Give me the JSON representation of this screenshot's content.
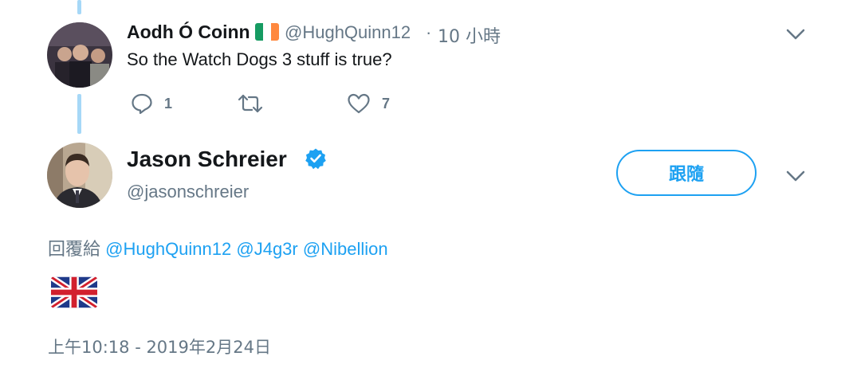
{
  "reply_tweet": {
    "display_name": "Aodh Ó Coinn",
    "handle": "@HughQuinn12",
    "separator": "·",
    "time_ago": "10 小時",
    "text": "So the Watch Dogs 3 stuff is true?",
    "reply_count": "1",
    "retweet_count": "",
    "like_count": "7",
    "icons": [
      "ireland-flag-emoji",
      "reply-icon",
      "retweet-icon",
      "like-icon",
      "chevron-down-icon"
    ]
  },
  "main_tweet": {
    "display_name": "Jason Schreier",
    "handle": "@jasonschreier",
    "follow_label": "跟隨",
    "replying_to_label": "回覆給",
    "mentions": [
      "@HughQuinn12",
      "@J4g3r",
      "@Nibellion"
    ],
    "timestamp": "上午10:18 - 2019年2月24日",
    "icons": [
      "verified-badge-icon",
      "uk-flag-emoji",
      "chevron-down-icon"
    ]
  },
  "colors": {
    "accent": "#1da1f2",
    "muted": "#657786",
    "thread_line": "#a6d8f7",
    "text": "#14171a"
  }
}
